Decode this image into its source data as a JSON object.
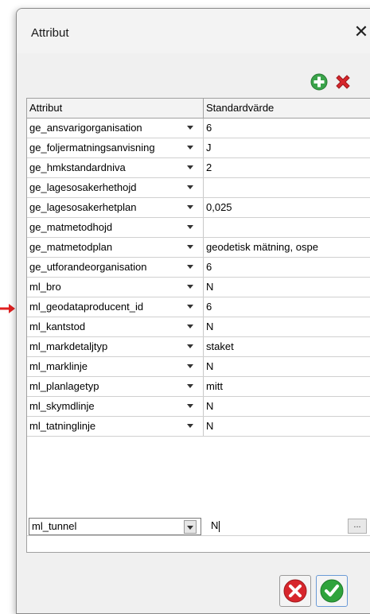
{
  "window": {
    "title": "Attribut",
    "close_glyph": "✕"
  },
  "toolbar": {
    "add_icon": "add-circle-icon",
    "delete_icon": "delete-x-icon",
    "add_color": "#3aa34a",
    "delete_color": "#d7262c"
  },
  "grid": {
    "columns": [
      "Attribut",
      "Standardvärde"
    ],
    "rows": [
      {
        "attr": "ge_ansvarigorganisation",
        "value": "6",
        "value_dropdown": false
      },
      {
        "attr": "ge_foljermatningsanvisning",
        "value": "J",
        "value_dropdown": false
      },
      {
        "attr": "ge_hmkstandardniva",
        "value": "2",
        "value_dropdown": false
      },
      {
        "attr": "ge_lagesosakerhethojd",
        "value": "",
        "value_dropdown": true
      },
      {
        "attr": "ge_lagesosakerhetplan",
        "value": "0,025",
        "value_dropdown": true
      },
      {
        "attr": "ge_matmetodhojd",
        "value": "",
        "value_dropdown": true
      },
      {
        "attr": "ge_matmetodplan",
        "value": "geodetisk mätning, ospe",
        "value_dropdown": true
      },
      {
        "attr": "ge_utforandeorganisation",
        "value": "6",
        "value_dropdown": false
      },
      {
        "attr": "ml_bro",
        "value": "N",
        "value_dropdown": false
      },
      {
        "attr": "ml_geodataproducent_id",
        "value": "6",
        "value_dropdown": false
      },
      {
        "attr": "ml_kantstod",
        "value": "N",
        "value_dropdown": false
      },
      {
        "attr": "ml_markdetaljtyp",
        "value": "staket",
        "value_dropdown": false
      },
      {
        "attr": "ml_marklinje",
        "value": "N",
        "value_dropdown": false
      },
      {
        "attr": "ml_planlagetyp",
        "value": "mitt",
        "value_dropdown": false
      },
      {
        "attr": "ml_skymdlinje",
        "value": "N",
        "value_dropdown": false
      },
      {
        "attr": "ml_tatninglinje",
        "value": "N",
        "value_dropdown": false
      }
    ],
    "editing_row": {
      "attr": "ml_tunnel",
      "value": "N",
      "ellipsis": "..."
    }
  },
  "footer": {
    "cancel_icon": "cancel-circle-icon",
    "ok_icon": "ok-check-icon",
    "cancel_color": "#d7262c",
    "ok_color": "#2fa33c"
  },
  "marker": {
    "icon": "red-arrow-icon",
    "color": "#e02020"
  }
}
